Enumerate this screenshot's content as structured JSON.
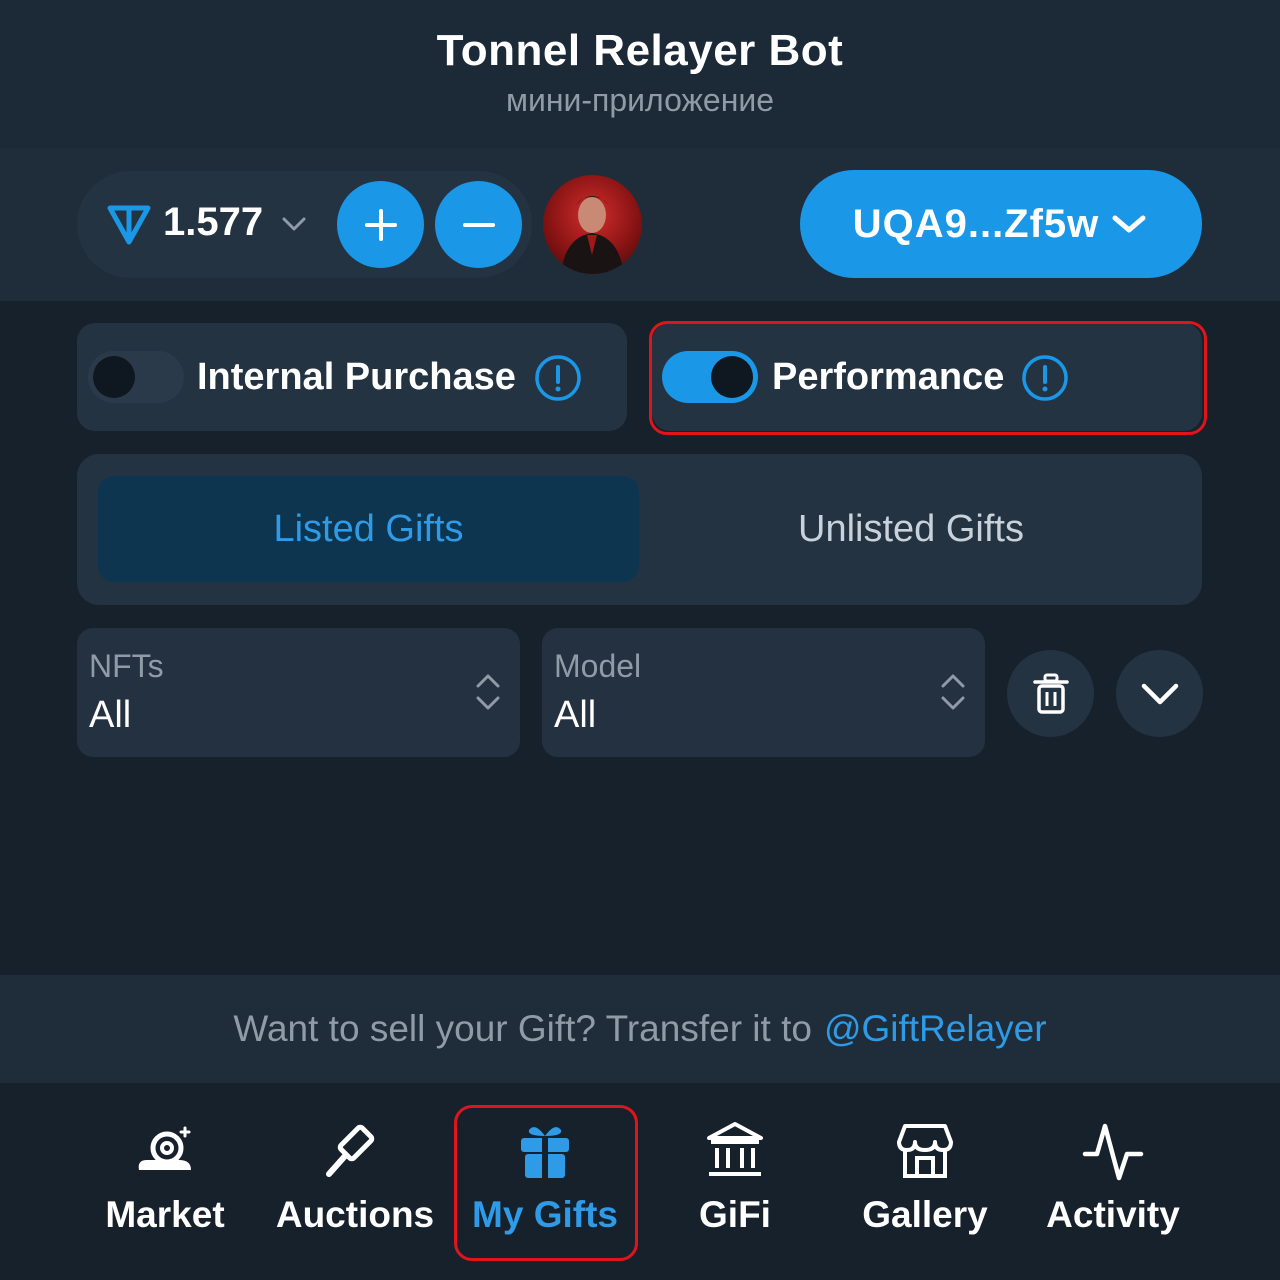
{
  "header": {
    "title": "Tonnel Relayer Bot",
    "subtitle": "мини-приложение"
  },
  "wallet": {
    "balance": "1.577",
    "address": "UQA9...Zf5w",
    "accent": "#1b97e8"
  },
  "toggles": [
    {
      "label": "Internal Purchase",
      "on": false
    },
    {
      "label": "Performance",
      "on": true
    }
  ],
  "tabs": {
    "listed": "Listed Gifts",
    "unlisted": "Unlisted Gifts",
    "active": "listed"
  },
  "filters": {
    "nfts": {
      "label": "NFTs",
      "value": "All"
    },
    "model": {
      "label": "Model",
      "value": "All"
    }
  },
  "sell": {
    "text": "Want to sell your Gift? Transfer it to",
    "link": "@GiftRelayer"
  },
  "nav": [
    {
      "label": "Market",
      "icon": "snail-icon"
    },
    {
      "label": "Auctions",
      "icon": "gavel-icon"
    },
    {
      "label": "My Gifts",
      "icon": "gift-icon",
      "active": true
    },
    {
      "label": "GiFi",
      "icon": "bank-icon"
    },
    {
      "label": "Gallery",
      "icon": "store-icon"
    },
    {
      "label": "Activity",
      "icon": "activity-icon"
    }
  ]
}
